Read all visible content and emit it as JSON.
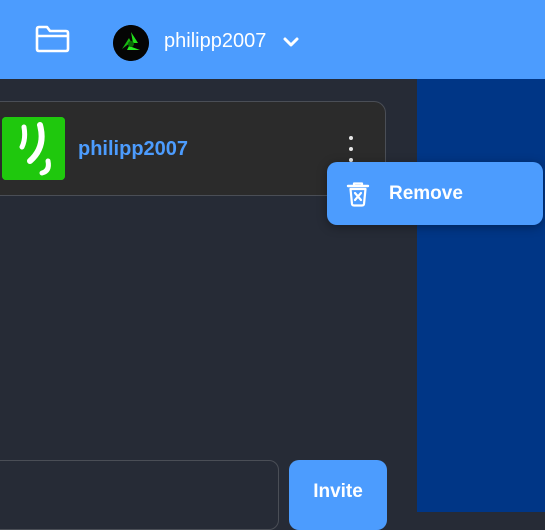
{
  "header": {
    "folder_icon": "folder-icon",
    "user": {
      "name": "philipp2007",
      "avatar_icon": "green-triskelion-logo",
      "chevron_icon": "chevron-down-icon"
    }
  },
  "member_card": {
    "name": "philipp2007",
    "avatar_icon": "green-swirl-avatar",
    "menu_icon": "kebab-menu-icon"
  },
  "context_menu": {
    "items": [
      {
        "label": "Remove",
        "icon": "trash-icon"
      }
    ]
  },
  "invite": {
    "input_value": "",
    "button_label": "Invite"
  },
  "colors": {
    "accent": "#4c9cfe",
    "panel_dark": "#262b36",
    "card": "#2b2b2b",
    "side_panel": "#003686",
    "avatar_green": "#1fc80d"
  }
}
